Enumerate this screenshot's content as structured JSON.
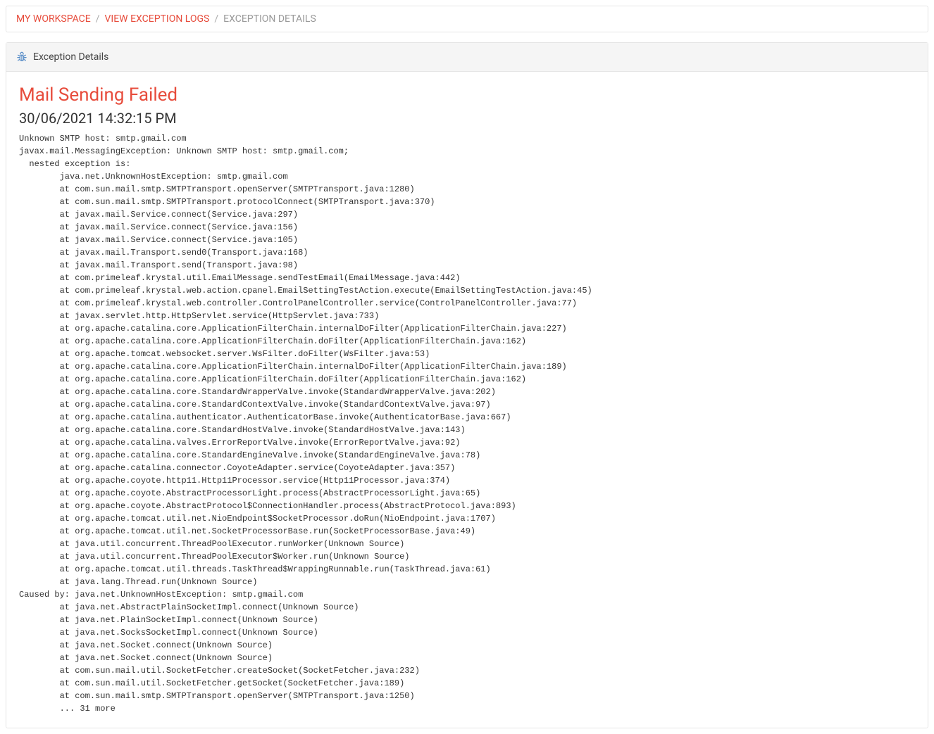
{
  "breadcrumb": {
    "items": [
      {
        "label": "MY WORKSPACE",
        "link": true
      },
      {
        "label": "VIEW EXCEPTION LOGS",
        "link": true
      },
      {
        "label": "EXCEPTION DETAILS",
        "link": false
      }
    ],
    "separator": "/"
  },
  "panel": {
    "header_title": "Exception Details"
  },
  "exception": {
    "title": "Mail Sending Failed",
    "timestamp": "30/06/2021 14:32:15 PM",
    "stacktrace": "Unknown SMTP host: smtp.gmail.com\njavax.mail.MessagingException: Unknown SMTP host: smtp.gmail.com;\n  nested exception is:\n        java.net.UnknownHostException: smtp.gmail.com\n        at com.sun.mail.smtp.SMTPTransport.openServer(SMTPTransport.java:1280)\n        at com.sun.mail.smtp.SMTPTransport.protocolConnect(SMTPTransport.java:370)\n        at javax.mail.Service.connect(Service.java:297)\n        at javax.mail.Service.connect(Service.java:156)\n        at javax.mail.Service.connect(Service.java:105)\n        at javax.mail.Transport.send0(Transport.java:168)\n        at javax.mail.Transport.send(Transport.java:98)\n        at com.primeleaf.krystal.util.EmailMessage.sendTestEmail(EmailMessage.java:442)\n        at com.primeleaf.krystal.web.action.cpanel.EmailSettingTestAction.execute(EmailSettingTestAction.java:45)\n        at com.primeleaf.krystal.web.controller.ControlPanelController.service(ControlPanelController.java:77)\n        at javax.servlet.http.HttpServlet.service(HttpServlet.java:733)\n        at org.apache.catalina.core.ApplicationFilterChain.internalDoFilter(ApplicationFilterChain.java:227)\n        at org.apache.catalina.core.ApplicationFilterChain.doFilter(ApplicationFilterChain.java:162)\n        at org.apache.tomcat.websocket.server.WsFilter.doFilter(WsFilter.java:53)\n        at org.apache.catalina.core.ApplicationFilterChain.internalDoFilter(ApplicationFilterChain.java:189)\n        at org.apache.catalina.core.ApplicationFilterChain.doFilter(ApplicationFilterChain.java:162)\n        at org.apache.catalina.core.StandardWrapperValve.invoke(StandardWrapperValve.java:202)\n        at org.apache.catalina.core.StandardContextValve.invoke(StandardContextValve.java:97)\n        at org.apache.catalina.authenticator.AuthenticatorBase.invoke(AuthenticatorBase.java:667)\n        at org.apache.catalina.core.StandardHostValve.invoke(StandardHostValve.java:143)\n        at org.apache.catalina.valves.ErrorReportValve.invoke(ErrorReportValve.java:92)\n        at org.apache.catalina.core.StandardEngineValve.invoke(StandardEngineValve.java:78)\n        at org.apache.catalina.connector.CoyoteAdapter.service(CoyoteAdapter.java:357)\n        at org.apache.coyote.http11.Http11Processor.service(Http11Processor.java:374)\n        at org.apache.coyote.AbstractProcessorLight.process(AbstractProcessorLight.java:65)\n        at org.apache.coyote.AbstractProtocol$ConnectionHandler.process(AbstractProtocol.java:893)\n        at org.apache.tomcat.util.net.NioEndpoint$SocketProcessor.doRun(NioEndpoint.java:1707)\n        at org.apache.tomcat.util.net.SocketProcessorBase.run(SocketProcessorBase.java:49)\n        at java.util.concurrent.ThreadPoolExecutor.runWorker(Unknown Source)\n        at java.util.concurrent.ThreadPoolExecutor$Worker.run(Unknown Source)\n        at org.apache.tomcat.util.threads.TaskThread$WrappingRunnable.run(TaskThread.java:61)\n        at java.lang.Thread.run(Unknown Source)\nCaused by: java.net.UnknownHostException: smtp.gmail.com\n        at java.net.AbstractPlainSocketImpl.connect(Unknown Source)\n        at java.net.PlainSocketImpl.connect(Unknown Source)\n        at java.net.SocksSocketImpl.connect(Unknown Source)\n        at java.net.Socket.connect(Unknown Source)\n        at java.net.Socket.connect(Unknown Source)\n        at com.sun.mail.util.SocketFetcher.createSocket(SocketFetcher.java:232)\n        at com.sun.mail.util.SocketFetcher.getSocket(SocketFetcher.java:189)\n        at com.sun.mail.smtp.SMTPTransport.openServer(SMTPTransport.java:1250)\n        ... 31 more"
  }
}
